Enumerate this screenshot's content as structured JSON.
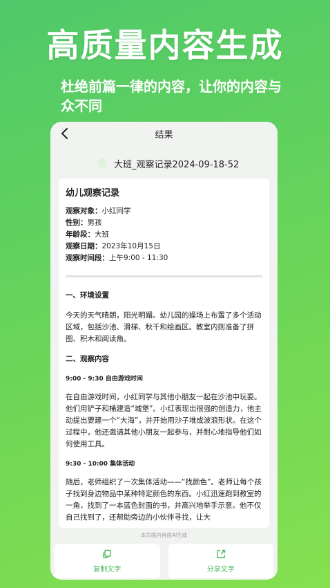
{
  "promo": {
    "headline": "高质量内容生成",
    "subline": "杜绝前篇一律的内容，让你的内容与众不同"
  },
  "nav": {
    "title": "结果"
  },
  "file": {
    "name": "大班_观察记录2024-09-18-52"
  },
  "doc": {
    "title": "幼儿观察记录",
    "meta": [
      {
        "key": "观察对象",
        "value": "小红同学"
      },
      {
        "key": "性别",
        "value": "男孩"
      },
      {
        "key": "年龄段",
        "value": "大班"
      },
      {
        "key": "观察日期",
        "value": "2023年10月15日"
      },
      {
        "key": "观察时间段",
        "value": "上午9:00 - 11:30"
      }
    ],
    "section1_title": "一、环境设置",
    "section1_text": "今天的天气晴朗，阳光明媚。幼儿园的操场上布置了多个活动区域，包括沙池、滑梯、秋千和绘画区。教室内则准备了拼图、积木和阅读角。",
    "section2_title": "二、观察内容",
    "period1_title": "9:00 - 9:30 自由游戏时间",
    "period1_text": "在自由游戏时间，小红同学与其他小朋友一起在沙池中玩耍。他们用铲子和桶建造“城堡”。小红表现出很强的创造力，他主动提出要建一个“大海”，并开始用沙子堆成波浪形状。在这个过程中，他还邀请其他小朋友一起参与，并耐心地指导他们如何使用工具。",
    "period2_title": "9:30 - 10:00 集体活动",
    "period2_text": "随后，老师组织了一次集体活动——“找颜色”。老师让每个孩子找到身边物品中某种特定颜色的东西。小红迅速跑到教室的一角，找到了一本蓝色封面的书，并高兴地举手示意。他不仅自己找到了，还帮助旁边的小伙伴寻找，让大"
  },
  "ai_note": "本页面内容由AI生成",
  "actions": {
    "copy_label": "复制文字",
    "share_label": "分享文字"
  },
  "colors": {
    "accent": "#47b85a"
  }
}
